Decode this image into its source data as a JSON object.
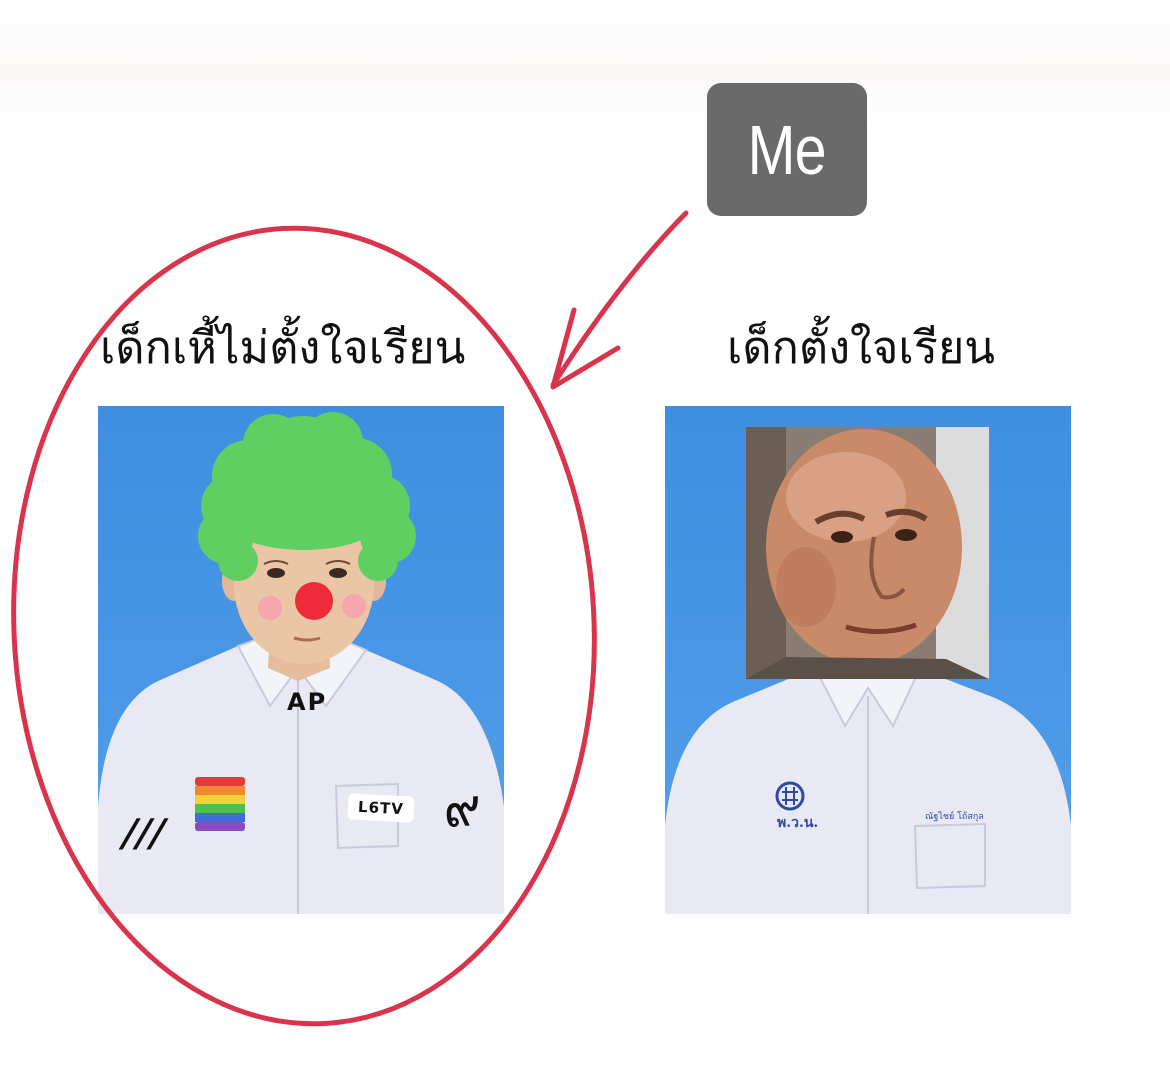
{
  "label": {
    "text": "Me"
  },
  "captions": {
    "left": "เด็กเหี้ไม่ตั้งใจเรียน",
    "right": "เด็กตั้งใจเรียน"
  },
  "left_photo": {
    "doodles": {
      "neck": "AP",
      "name_tag": "L6TV",
      "sleeve_tally": "///",
      "sleeve_number": "๙"
    }
  },
  "right_photo": {
    "school_name": "พ.ว.น.",
    "student_name": "ณัฐไชย์ โถ้สกุล"
  },
  "colors": {
    "background": "#ffffff",
    "badge": "#6a6a6a",
    "circle_and_arrow": "#d8344b",
    "photo_backdrop": "#4a98e6",
    "clown_wig": "#5fcf62",
    "clown_nose": "#ef2b3b",
    "shirt": "#e8e9f3"
  }
}
